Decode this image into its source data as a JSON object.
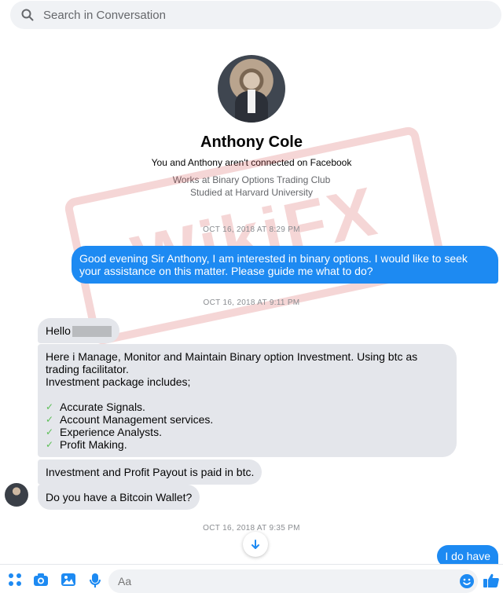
{
  "search": {
    "placeholder": "Search in Conversation"
  },
  "profile": {
    "name": "Anthony Cole",
    "connection": "You and Anthony aren't connected on Facebook",
    "work": "Works at Binary Options Trading Club",
    "education": "Studied at Harvard University"
  },
  "watermark": "WikiFX",
  "messages": {
    "ts1": "OCT 16, 2018 AT 8:29 PM",
    "out1": "Good evening Sir Anthony, I am interested in binary options. I would like to seek your assistance on this matter. Please guide me what to do?",
    "ts2": "OCT 16, 2018 AT 9:11 PM",
    "in1": "Hello",
    "in2_line1": "Here i Manage, Monitor and Maintain Binary  option Investment. Using btc as trading facilitator.",
    "in2_line2": "Investment package includes;",
    "in2_items": [
      "Accurate Signals.",
      "Account Management services.",
      "Experience  Analysts.",
      "Profit Making."
    ],
    "in3": "Investment and Profit Payout is paid in btc.",
    "in4": "Do you have a Bitcoin Wallet?",
    "ts3": "OCT 16, 2018 AT 9:35 PM",
    "out2": "I do have"
  },
  "composer": {
    "placeholder": "Aa"
  },
  "colors": {
    "accent": "#1d8af2",
    "incoming": "#e4e6eb"
  }
}
